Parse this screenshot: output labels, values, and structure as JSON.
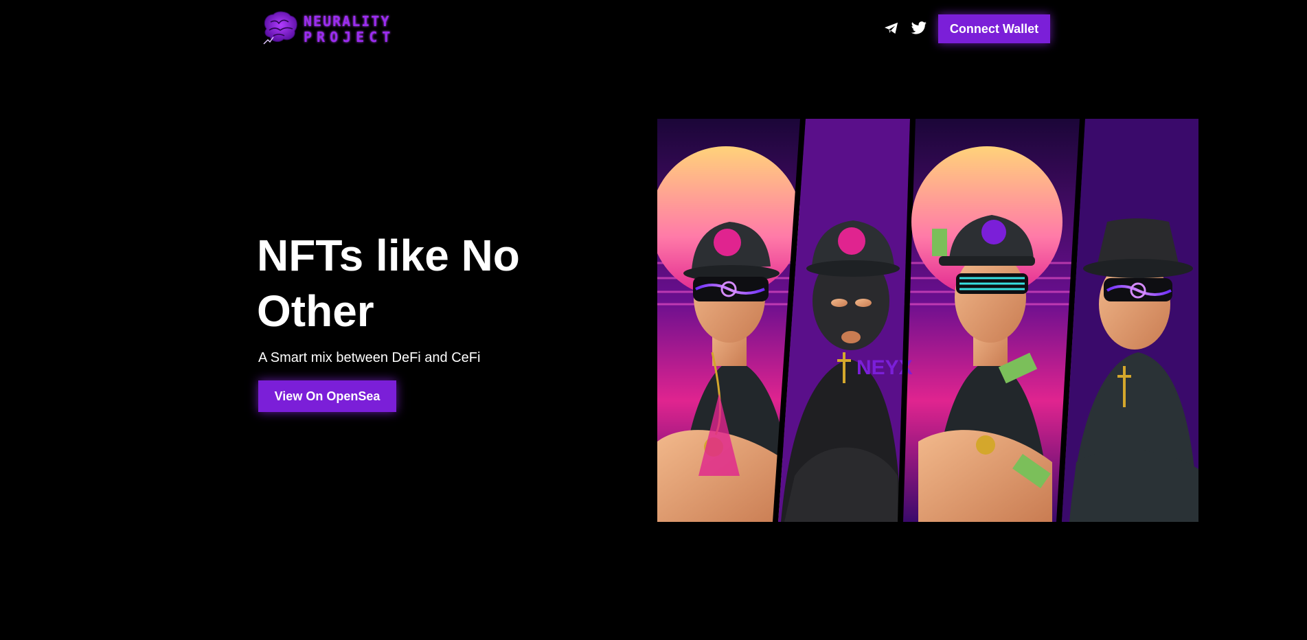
{
  "header": {
    "logo_line1": "NEURALITY",
    "logo_line2": "PROJECT",
    "connect_label": "Connect Wallet",
    "social_icons": [
      "telegram-icon",
      "twitter-icon"
    ]
  },
  "hero": {
    "title": "NFTs like No Other",
    "subtitle": "A Smart mix between DeFi and CeFi",
    "cta_label": "View On OpenSea"
  },
  "art": {
    "badge_text": "NEYX",
    "panels": 4
  },
  "colors": {
    "accent": "#7b1fd8",
    "background": "#000000",
    "text": "#ffffff"
  }
}
